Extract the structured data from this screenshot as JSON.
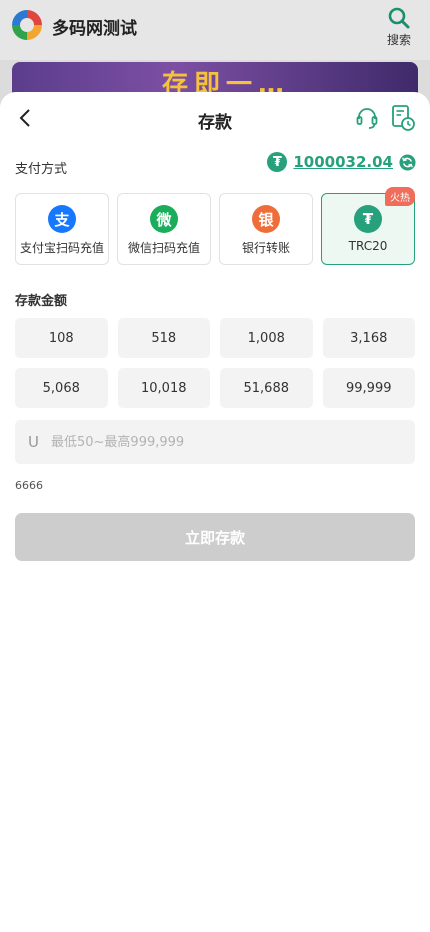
{
  "background": {
    "app_title": "多码网测试",
    "search_label": "搜索",
    "banner_text": "存即一…"
  },
  "header": {
    "title": "存款"
  },
  "payment": {
    "label": "支付方式",
    "balance": "1000032.04",
    "currency_symbol": "₮"
  },
  "methods": [
    {
      "label": "支付宝扫码充值",
      "glyph": "支",
      "color": "#1677ff"
    },
    {
      "label": "微信扫码充值",
      "glyph": "微",
      "color": "#1aad5a"
    },
    {
      "label": "银行转账",
      "glyph": "银",
      "color": "#ef6d3b"
    },
    {
      "label": "TRC20",
      "glyph": "₮",
      "color": "#26a17b",
      "badge": "火热",
      "selected": true
    }
  ],
  "amount": {
    "label": "存款金额",
    "presets": [
      "108",
      "518",
      "1,008",
      "3,168",
      "5,068",
      "10,018",
      "51,688",
      "99,999"
    ],
    "unit": "U",
    "placeholder": "最低50~最高999,999",
    "value": ""
  },
  "note": "6666",
  "submit_label": "立即存款",
  "colors": {
    "accent": "#26a17b",
    "hot_badge": "#ef6d5a",
    "submit_disabled": "#cdcdcd"
  }
}
